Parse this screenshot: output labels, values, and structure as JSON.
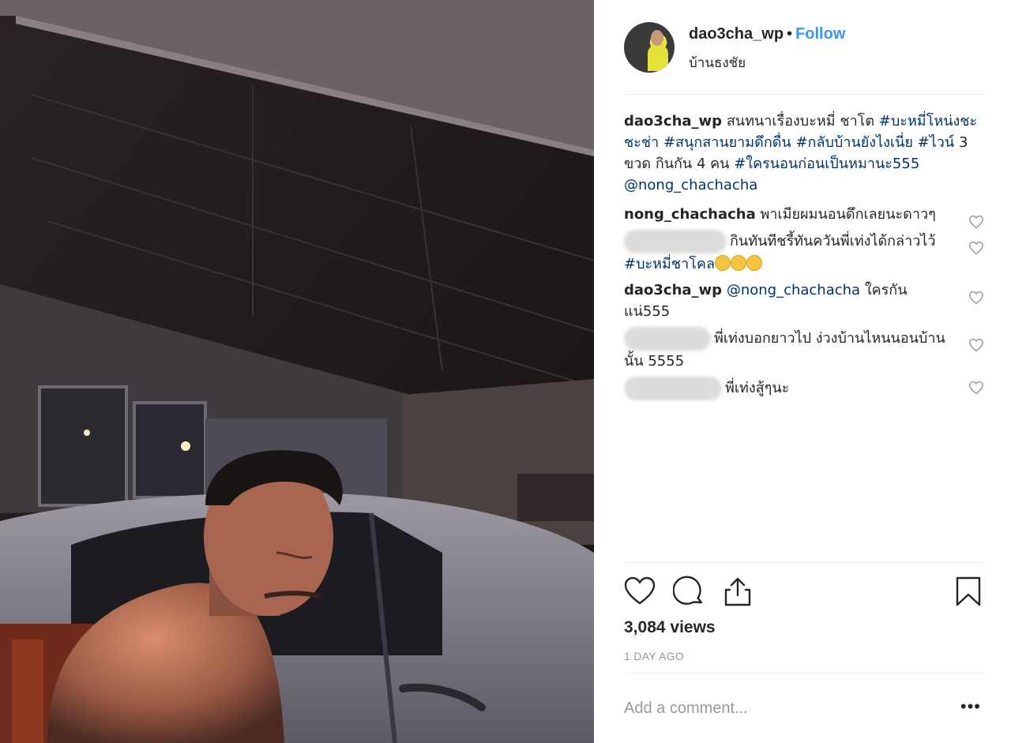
{
  "post": {
    "username": "dao3cha_wp",
    "follow_label": "Follow",
    "separator": "•",
    "location": "บ้านธงชัย"
  },
  "caption": {
    "user": "dao3cha_wp",
    "text1": "สนทนาเรื่องบะหมี่ ชาโต",
    "tag1": "#บะหมี่โหน่งชะชะช่า",
    "tag2": "#สนุกสานยามดึกดื่น",
    "tag3": "#กลับบ้านยังไงเนี่ย",
    "tag4": "#ไวน์",
    "text2": "3 ขวด กินกัน 4 คน",
    "tag5": "#ใครนอนก่อนเป็นหมานะ555",
    "mention": "@nong_chachacha"
  },
  "comments": [
    {
      "user": "nong_chachacha",
      "text": "พาเมียผมนอนดึกเลยนะดาวๆ"
    },
    {
      "user": "",
      "text": "กินทันทีชรี้ทันควันพี่เท่งได้กล่าวไว้",
      "tag": "#บะหมี่ชาโคล"
    },
    {
      "user": "dao3cha_wp",
      "mention": "@nong_chachacha",
      "text": "ใครกันแน่555"
    },
    {
      "user": "",
      "text": "พี่เท่งบอกยาวไป ง่วงบ้านไหนนอนบ้านนั้น 5555"
    },
    {
      "user": "",
      "text": "พี่เท่งสู้ๆนะ"
    }
  ],
  "stats": {
    "views": "3,084 views",
    "time": "1 DAY AGO"
  },
  "composer": {
    "placeholder": "Add a comment...",
    "more": "•••"
  },
  "icons": {
    "like": "heart-icon",
    "comment": "comment-icon",
    "share": "share-icon",
    "save": "bookmark-icon",
    "comment_like": "heart-icon"
  },
  "colors": {
    "link": "#3897f0",
    "hashtag": "#003569",
    "muted": "#999999",
    "text": "#262626"
  }
}
